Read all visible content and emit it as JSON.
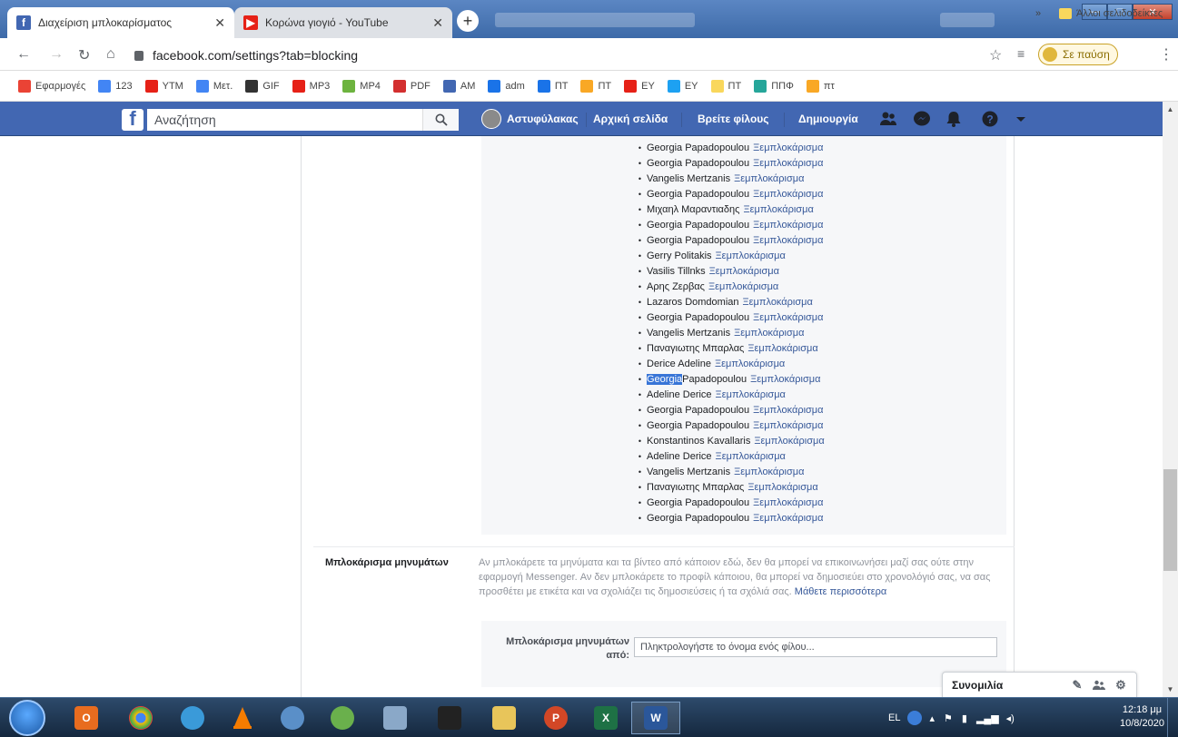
{
  "browser": {
    "tabs": [
      {
        "title": "Διαχείριση μπλοκαρίσματος",
        "icon": "facebook-icon",
        "active": true
      },
      {
        "title": "Κορώνα γιογιό - YouTube",
        "icon": "youtube-icon",
        "active": false
      }
    ],
    "new_tab": "+",
    "url": "facebook.com/settings?tab=blocking",
    "profile_label": "Σε παύση",
    "bookmarks": [
      {
        "label": "Εφαρμογές",
        "icon": "apps-icon",
        "color": "#ea4335"
      },
      {
        "label": "123",
        "icon": "google-icon",
        "color": "#4285f4"
      },
      {
        "label": "YTM",
        "icon": "youtube-music-icon",
        "color": "#e62117"
      },
      {
        "label": "Μετ.",
        "icon": "translate-icon",
        "color": "#4285f4"
      },
      {
        "label": "GIF",
        "icon": "gif-icon",
        "color": "#333333"
      },
      {
        "label": "MP3",
        "icon": "mp3-icon",
        "color": "#e62117"
      },
      {
        "label": "MP4",
        "icon": "download-icon",
        "color": "#6db33f"
      },
      {
        "label": "PDF",
        "icon": "pdf-icon",
        "color": "#d32f2f"
      },
      {
        "label": "AM",
        "icon": "facebook-icon",
        "color": "#4267b2"
      },
      {
        "label": "adm",
        "icon": "tool-icon",
        "color": "#1a73e8"
      },
      {
        "label": "ΠΤ",
        "icon": "tool-icon",
        "color": "#1a73e8"
      },
      {
        "label": "ΠΤ",
        "icon": "chart-icon",
        "color": "#f9a825"
      },
      {
        "label": "ΕΥ",
        "icon": "youtube-icon",
        "color": "#e62117"
      },
      {
        "label": "ΕΥ",
        "icon": "twitter-icon",
        "color": "#1da1f2"
      },
      {
        "label": "ΠΤ",
        "icon": "folder-icon",
        "color": "#f9d75c"
      },
      {
        "label": "ΠΠΦ",
        "icon": "pp-icon",
        "color": "#26a69a"
      },
      {
        "label": "πτ",
        "icon": "chart-icon",
        "color": "#f9a825"
      }
    ],
    "bookmarks_more": "»",
    "other_bookmarks": "Άλλοι σελιδοδείκτες"
  },
  "fb": {
    "search_placeholder": "Αναζήτηση",
    "profile_name": "Αστυφύλακας",
    "nav": [
      "Αρχική σελίδα",
      "Βρείτε φίλους",
      "Δημιουργία"
    ]
  },
  "blocked_users": {
    "unblock_label": "Ξεμπλοκάρισμα",
    "items": [
      "Georgia Papadopoulou",
      "Georgia Papadopoulou",
      "Vangelis Mertzanis",
      "Georgia Papadopoulou",
      "Μιχαηλ Μαραντιαδης",
      "Georgia Papadopoulou",
      "Georgia Papadopoulou",
      "Gerry Politakis",
      "Vasilis Tillnks",
      "Αρης Ζερβας",
      "Lazaros Domdomian",
      "Georgia Papadopoulou",
      "Vangelis Mertzanis",
      "Παναγιωτης Μπαρλας",
      "Derice Adeline",
      "Georgia Papadopoulou",
      "Adeline Derice",
      "Georgia Papadopoulou",
      "Georgia Papadopoulou",
      "Konstantinos Kavallaris",
      "Adeline Derice",
      "Vangelis Mertzanis",
      "Παναγιωτης Μπαρλας",
      "Georgia Papadopoulou",
      "Georgia Papadopoulou"
    ],
    "selected_index": 15,
    "selected_word": "Georgia",
    "selected_rest": "Papadopoulou"
  },
  "message_blocking": {
    "label": "Μπλοκάρισμα μηνυμάτων",
    "description": "Αν μπλοκάρετε τα μηνύματα και τα βίντεο από κάποιον εδώ, δεν θα μπορεί να επικοινωνήσει μαζί σας ούτε στην εφαρμογή Messenger. Αν δεν μπλοκάρετε το προφίλ κάποιου, θα μπορεί να δημοσιεύει στο χρονολόγιό σας, να σας προσθέτει με ετικέτα και να σχολιάζει τις δημοσιεύσεις ή τα σχόλιά σας.",
    "learn_more": "Μάθετε περισσότερα",
    "form_label": "Μπλοκάρισμα μηνυμάτων από:",
    "input_placeholder": "Πληκτρολογήστε το όνομα ενός φίλου..."
  },
  "chat": {
    "label": "Συνομιλία"
  },
  "taskbar": {
    "language": "EL",
    "time": "12:18 μμ",
    "date": "10/8/2020"
  },
  "colors": {
    "fb_blue": "#4267b2",
    "link_blue": "#365899",
    "selection": "#3875d7"
  }
}
